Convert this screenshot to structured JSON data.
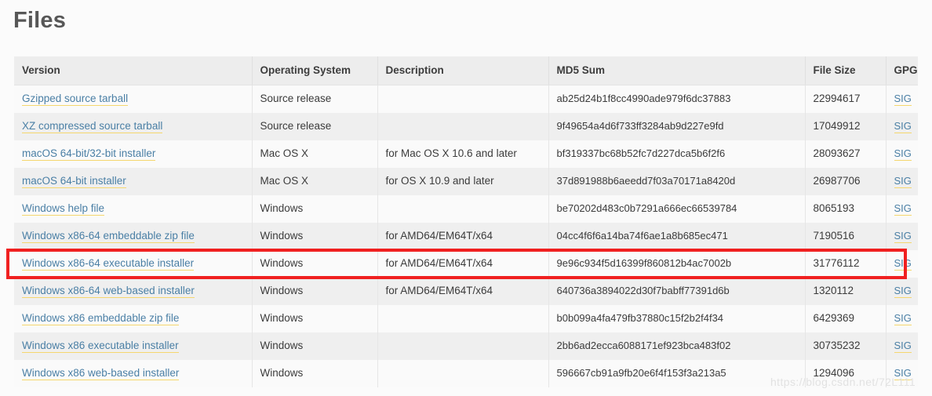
{
  "page": {
    "title": "Files",
    "watermark": "https://blog.csdn.net/72L111",
    "highlight_color": "#f02020",
    "link_color": "#4a7fa5",
    "link_underline_color": "#f5d76e"
  },
  "table": {
    "columns": [
      "Version",
      "Operating System",
      "Description",
      "MD5 Sum",
      "File Size",
      "GPG"
    ],
    "gpg_label": "SIG",
    "rows": [
      {
        "version": "Gzipped source tarball",
        "os": "Source release",
        "description": "",
        "md5": "ab25d24b1f8cc4990ade979f6dc37883",
        "size": "22994617",
        "gpg": "SIG",
        "highlighted": false
      },
      {
        "version": "XZ compressed source tarball",
        "os": "Source release",
        "description": "",
        "md5": "9f49654a4d6f733ff3284ab9d227e9fd",
        "size": "17049912",
        "gpg": "SIG",
        "highlighted": false
      },
      {
        "version": "macOS 64-bit/32-bit installer",
        "os": "Mac OS X",
        "description": "for Mac OS X 10.6 and later",
        "md5": "bf319337bc68b52fc7d227dca5b6f2f6",
        "size": "28093627",
        "gpg": "SIG",
        "highlighted": false
      },
      {
        "version": "macOS 64-bit installer",
        "os": "Mac OS X",
        "description": "for OS X 10.9 and later",
        "md5": "37d891988b6aeedd7f03a70171a8420d",
        "size": "26987706",
        "gpg": "SIG",
        "highlighted": false
      },
      {
        "version": "Windows help file",
        "os": "Windows",
        "description": "",
        "md5": "be70202d483c0b7291a666ec66539784",
        "size": "8065193",
        "gpg": "SIG",
        "highlighted": false
      },
      {
        "version": "Windows x86-64 embeddable zip file",
        "os": "Windows",
        "description": "for AMD64/EM64T/x64",
        "md5": "04cc4f6f6a14ba74f6ae1a8b685ec471",
        "size": "7190516",
        "gpg": "SIG",
        "highlighted": false
      },
      {
        "version": "Windows x86-64 executable installer",
        "os": "Windows",
        "description": "for AMD64/EM64T/x64",
        "md5": "9e96c934f5d16399f860812b4ac7002b",
        "size": "31776112",
        "gpg": "SIG",
        "highlighted": true
      },
      {
        "version": "Windows x86-64 web-based installer",
        "os": "Windows",
        "description": "for AMD64/EM64T/x64",
        "md5": "640736a3894022d30f7babff77391d6b",
        "size": "1320112",
        "gpg": "SIG",
        "highlighted": false
      },
      {
        "version": "Windows x86 embeddable zip file",
        "os": "Windows",
        "description": "",
        "md5": "b0b099a4fa479fb37880c15f2b2f4f34",
        "size": "6429369",
        "gpg": "SIG",
        "highlighted": false
      },
      {
        "version": "Windows x86 executable installer",
        "os": "Windows",
        "description": "",
        "md5": "2bb6ad2ecca6088171ef923bca483f02",
        "size": "30735232",
        "gpg": "SIG",
        "highlighted": false
      },
      {
        "version": "Windows x86 web-based installer",
        "os": "Windows",
        "description": "",
        "md5": "596667cb91a9fb20e6f4f153f3a213a5",
        "size": "1294096",
        "gpg": "SIG",
        "highlighted": false
      }
    ]
  }
}
